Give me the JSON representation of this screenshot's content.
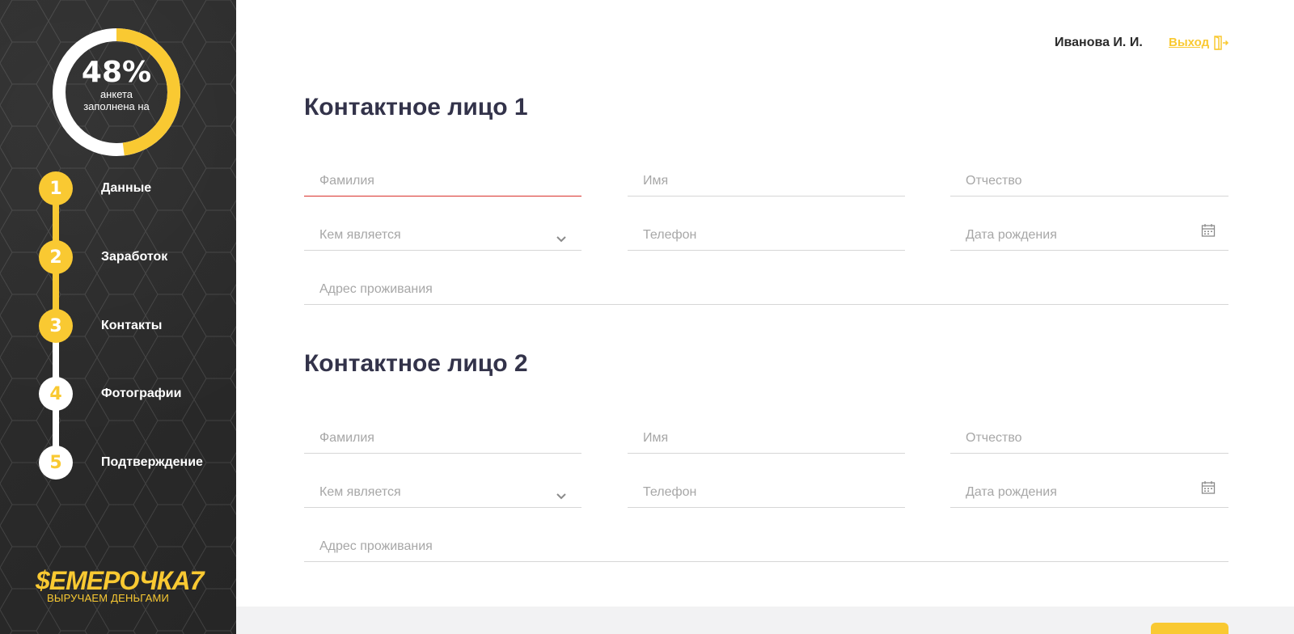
{
  "progress": {
    "percent_text": "48%",
    "caption": "анкета заполнена на",
    "fraction": 0.48,
    "color": "#f9c932"
  },
  "steps": [
    {
      "number": "1",
      "label": "Данные",
      "state": "done"
    },
    {
      "number": "2",
      "label": "Заработок",
      "state": "done"
    },
    {
      "number": "3",
      "label": "Контакты",
      "state": "done"
    },
    {
      "number": "4",
      "label": "Фотографии",
      "state": "todo"
    },
    {
      "number": "5",
      "label": "Подтверждение",
      "state": "todo"
    }
  ],
  "logo": {
    "main": "$ЕМЕРОЧКА7",
    "sub": "ВЫРУЧАЕМ ДЕНЬГАМИ"
  },
  "header": {
    "user_name": "Иванова И. И.",
    "logout_label": "Выход"
  },
  "contact1": {
    "title": "Контактное лицо 1",
    "last_name_placeholder": "Фамилия",
    "first_name_placeholder": "Имя",
    "middle_name_placeholder": "Отчество",
    "relation_placeholder": "Кем является",
    "phone_placeholder": "Телефон",
    "birth_date_placeholder": "Дата рождения",
    "address_placeholder": "Адрес проживания"
  },
  "contact2": {
    "title": "Контактное лицо 2",
    "last_name_placeholder": "Фамилия",
    "first_name_placeholder": "Имя",
    "middle_name_placeholder": "Отчество",
    "relation_placeholder": "Кем является",
    "phone_placeholder": "Телефон",
    "birth_date_placeholder": "Дата рождения",
    "address_placeholder": "Адрес проживания"
  },
  "colors": {
    "accent": "#f9c932",
    "sidebar_bg": "#2b2b2b",
    "title": "#33334a",
    "active_underline": "#d9312c"
  }
}
